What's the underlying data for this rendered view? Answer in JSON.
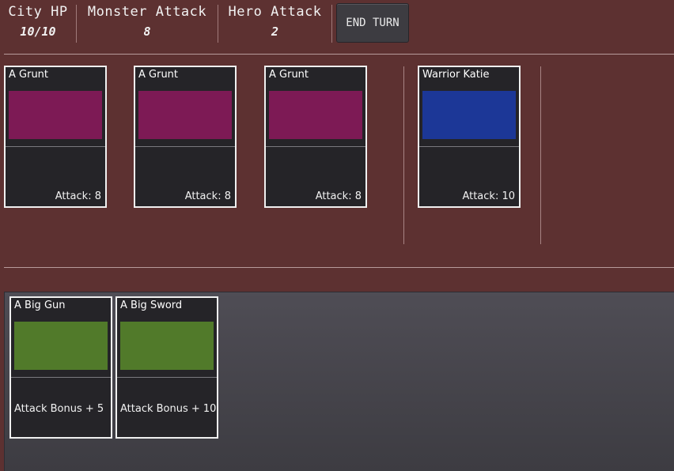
{
  "stats": {
    "city_hp": {
      "label": "City HP",
      "value": "10/10"
    },
    "monster_attack": {
      "label": "Monster Attack",
      "value": "8"
    },
    "hero_attack": {
      "label": "Hero Attack",
      "value": "2"
    }
  },
  "end_turn_label": "END TURN",
  "monsters": [
    {
      "name": "A Grunt",
      "attack": "Attack: 8"
    },
    {
      "name": "A Grunt",
      "attack": "Attack: 8"
    },
    {
      "name": "A Grunt",
      "attack": "Attack: 8"
    }
  ],
  "hero": {
    "name": "Warrior Katie",
    "attack": "Attack: 10"
  },
  "hand": [
    {
      "name": "A Big Gun",
      "bonus": "Attack Bonus + 5"
    },
    {
      "name": "A Big Sword",
      "bonus": "Attack Bonus + 10"
    }
  ],
  "colors": {
    "background": "#5d3131",
    "monster_art": "#7d1a55",
    "hero_art": "#1c3797",
    "item_art": "#517a2a",
    "card_bg": "#252428"
  }
}
